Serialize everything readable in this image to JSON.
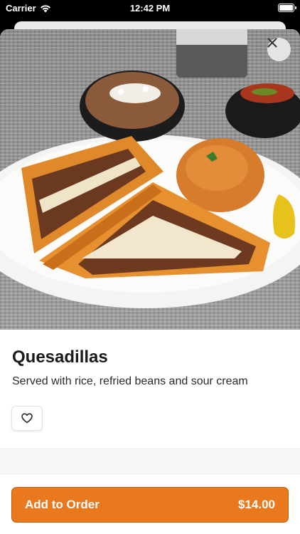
{
  "status_bar": {
    "carrier": "Carrier",
    "time": "12:42 PM"
  },
  "sheet": {
    "close_icon": "close-icon",
    "image_alt": "Quesadillas with rice, refried beans and salsa"
  },
  "item": {
    "title": "Quesadillas",
    "description": "Served with rice, refried beans and sour cream",
    "favorite_icon": "heart-icon"
  },
  "order_button": {
    "label": "Add to Order",
    "price": "$14.00"
  },
  "colors": {
    "accent": "#e9791c",
    "accent_border": "#b9600f",
    "text": "#1a1a1a"
  }
}
